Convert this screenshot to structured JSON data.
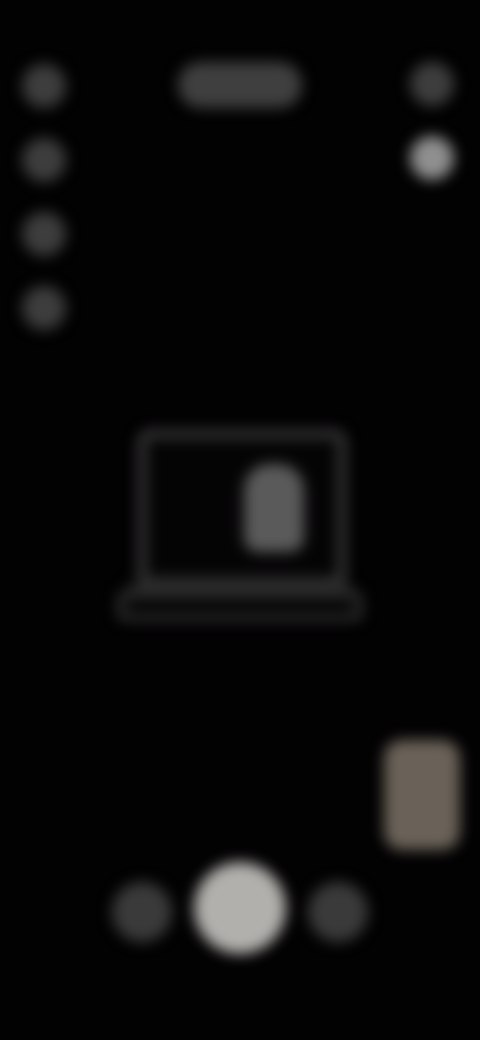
{
  "status_bar": {
    "time": "",
    "indicators": ""
  },
  "camera_mode_title": "",
  "left_controls": [
    {
      "icon": "flash-icon"
    },
    {
      "icon": "timer-icon"
    },
    {
      "icon": "aspect-ratio-icon"
    },
    {
      "icon": "filter-icon"
    }
  ],
  "right_controls": [
    {
      "icon": "settings-icon"
    },
    {
      "icon": "flip-icon"
    }
  ],
  "center_illustration": {
    "icon": "laptop-person-icon"
  },
  "gallery": {
    "icon": "gallery-thumbnail"
  },
  "bottom_controls": [
    {
      "icon": "effects-icon"
    },
    {
      "icon": "shutter-button"
    },
    {
      "icon": "switch-camera-icon"
    }
  ],
  "colors": {
    "background": "#030203",
    "icon_gray": "#3d3d3d",
    "shutter": "#b2b0ad",
    "thumbnail": "#6a6258"
  }
}
